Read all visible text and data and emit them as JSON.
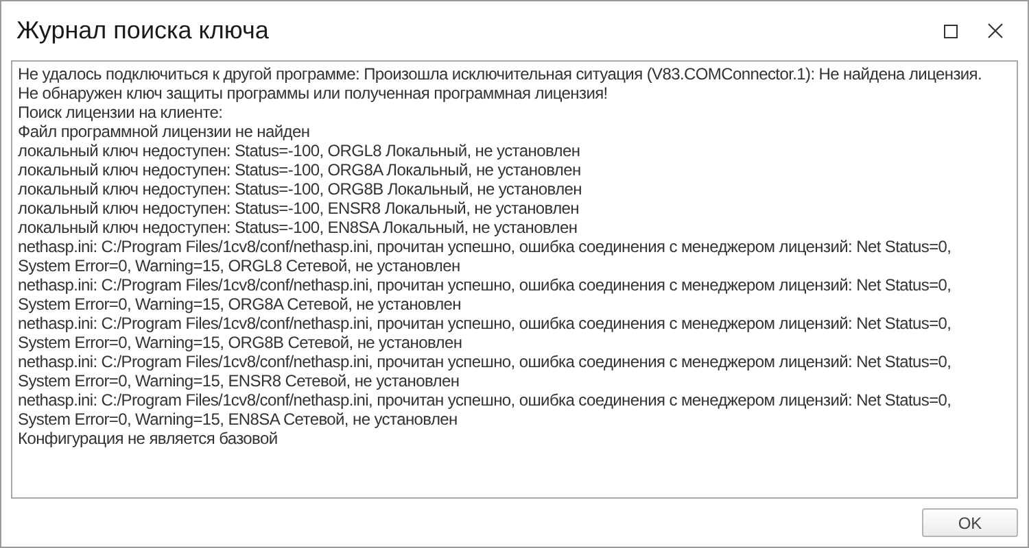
{
  "window": {
    "title": "Журнал поиска ключа"
  },
  "log": {
    "lines": [
      "Не удалось подключиться к другой программе: Произошла исключительная ситуация (V83.COMConnector.1): Не найдена лицензия. Не обнаружен ключ защиты программы или полученная программная лицензия!",
      "Поиск лицензии на клиенте:",
      "Файл программной лицензии не найден",
      "локальный ключ недоступен: Status=-100, ORGL8 Локальный, не установлен",
      "локальный ключ недоступен: Status=-100, ORG8A Локальный, не установлен",
      "локальный ключ недоступен: Status=-100, ORG8B Локальный, не установлен",
      "локальный ключ недоступен: Status=-100, ENSR8 Локальный, не установлен",
      "локальный ключ недоступен: Status=-100, EN8SA Локальный, не установлен",
      "nethasp.ini: C:/Program Files/1cv8/conf/nethasp.ini, прочитан успешно, ошибка соединения с менеджером лицензий: Net Status=0, System Error=0, Warning=15, ORGL8 Сетевой, не установлен",
      "nethasp.ini: C:/Program Files/1cv8/conf/nethasp.ini, прочитан успешно, ошибка соединения с менеджером лицензий: Net Status=0, System Error=0, Warning=15, ORG8A Сетевой, не установлен",
      "nethasp.ini: C:/Program Files/1cv8/conf/nethasp.ini, прочитан успешно, ошибка соединения с менеджером лицензий: Net Status=0, System Error=0, Warning=15, ORG8B Сетевой, не установлен",
      "nethasp.ini: C:/Program Files/1cv8/conf/nethasp.ini, прочитан успешно, ошибка соединения с менеджером лицензий: Net Status=0, System Error=0, Warning=15, ENSR8 Сетевой, не установлен",
      "nethasp.ini: C:/Program Files/1cv8/conf/nethasp.ini, прочитан успешно, ошибка соединения с менеджером лицензий: Net Status=0, System Error=0, Warning=15, EN8SA Сетевой, не установлен",
      "Конфигурация не является базовой"
    ]
  },
  "buttons": [
    {
      "label": "OK"
    }
  ]
}
